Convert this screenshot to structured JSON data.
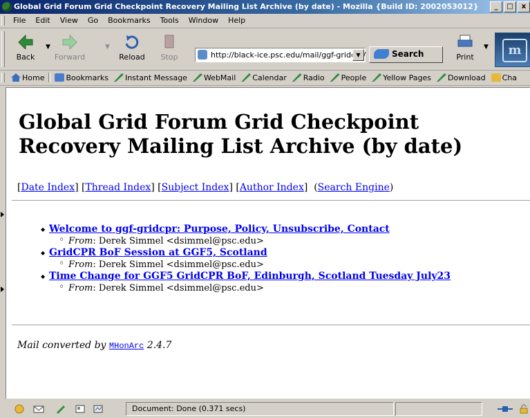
{
  "window": {
    "title": "Global Grid Forum Grid Checkpoint Recovery Mailing List Archive (by date) - Mozilla {Build ID: 2002053012}",
    "buttons": [
      "_",
      "□",
      "x"
    ]
  },
  "menubar": [
    "File",
    "Edit",
    "View",
    "Go",
    "Bookmarks",
    "Tools",
    "Window",
    "Help"
  ],
  "navigation": {
    "back": "Back",
    "forward": "Forward",
    "reload": "Reload",
    "stop": "Stop",
    "url": "http://black-ice.psc.edu/mail/ggf-gridcpr/",
    "search": "Search",
    "print": "Print"
  },
  "personal_toolbar": [
    "Home",
    "Bookmarks",
    "Instant Message",
    "WebMail",
    "Calendar",
    "Radio",
    "People",
    "Yellow Pages",
    "Download",
    "Cha"
  ],
  "page": {
    "heading": "Global Grid Forum Grid Checkpoint Recovery Mailing List Archive (by date)",
    "index_links": [
      "Date Index",
      "Thread Index",
      "Subject Index",
      "Author Index"
    ],
    "search_engine": "Search Engine",
    "messages": [
      {
        "subject": "Welcome to ggf-gridcpr: Purpose, Policy, Unsubscribe, Contact",
        "from_label": "From",
        "from": "Derek Simmel <dsimmel@psc.edu>"
      },
      {
        "subject": "GridCPR BoF Session at GGF5, Scotland",
        "from_label": "From",
        "from": "Derek Simmel <dsimmel@psc.edu>"
      },
      {
        "subject": "Time Change for GGF5 GridCPR BoF, Edinburgh, Scotland Tuesday July23",
        "from_label": "From",
        "from": "Derek Simmel <dsimmel@psc.edu>"
      }
    ],
    "footer_prefix": "Mail converted by",
    "footer_link": "MHonArc",
    "footer_version": "2.4.7"
  },
  "status": {
    "text": "Document: Done (0.371 secs)"
  },
  "colors": {
    "link": "#0000ee",
    "titlebar": "#0a246a",
    "chrome": "#d4d0c8"
  }
}
